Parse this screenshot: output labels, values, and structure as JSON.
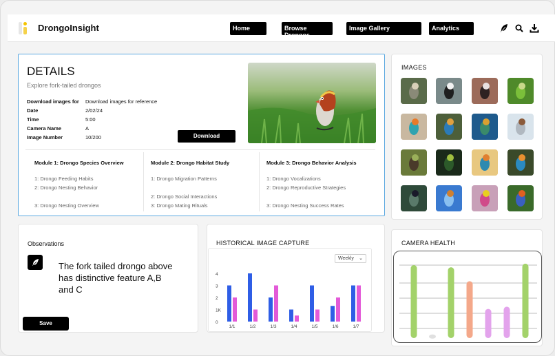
{
  "brand": {
    "name": "DrongoInsight"
  },
  "nav": {
    "home": "Home",
    "browse": "Browse Drongos",
    "gallery": "Image Gallery",
    "analytics": "Analytics"
  },
  "details": {
    "title": "DETAILS",
    "subtitle": "Explore fork-tailed drongos",
    "fields": [
      {
        "key": "Download images for",
        "value": "Download images for reference"
      },
      {
        "key": "Date",
        "value": "2/02/24"
      },
      {
        "key": "Time",
        "value": "5:00"
      },
      {
        "key": "Camera Name",
        "value": "A"
      },
      {
        "key": "Image Number",
        "value": "10/200"
      }
    ],
    "download_label": "Download",
    "modules": [
      {
        "title": "Module 1: Drongo Species Overview",
        "items": [
          "1: Drongo Feeding Habits",
          "2: Drongo Nesting Behavior",
          "3: Drongo Nesting Overview"
        ]
      },
      {
        "title": "Module 2: Drongo Habitat Study",
        "items": [
          "1: Drongo Migration Patterns",
          "2: Drongo Social Interactions",
          "3: Drongo Mating Rituals"
        ]
      },
      {
        "title": "Module 3: Drongo Behavior Analysis",
        "items": [
          "1: Drongo Vocalizations",
          "2: Drongo Reproductive Strategies",
          "3: Drongo Nesting Success Rates"
        ]
      }
    ]
  },
  "images": {
    "title": "IMAGES"
  },
  "observations": {
    "title": "Observations",
    "text": "The fork tailed drongo above has distinctive feature A,B and C",
    "save_label": "Save"
  },
  "history": {
    "title": "HISTORICAL IMAGE CAPTURE",
    "period": "Weekly"
  },
  "camera_health": {
    "title": "CAMERA HEALTH"
  },
  "colors": {
    "series_a": "#2f5ee6",
    "series_b": "#e35ad8",
    "health_green": "#a3d26a",
    "health_salmon": "#f4a88a",
    "health_lilac": "#e3a3ec",
    "accent_border": "#5aa8e0"
  },
  "chart_data": [
    {
      "type": "bar",
      "categories": [
        "1/1",
        "1/2",
        "1/3",
        "1/4",
        "1/5",
        "1/6",
        "1/7"
      ],
      "y_ticks": [
        "0",
        "1K",
        "2",
        "3",
        "4"
      ],
      "ylim": [
        0,
        4
      ],
      "series": [
        {
          "values": [
            3,
            4,
            2,
            1,
            3,
            1.3,
            3
          ]
        },
        {
          "values": [
            2,
            1,
            3,
            0.5,
            1,
            2,
            3
          ]
        }
      ]
    },
    {
      "type": "bar",
      "ylim": [
        0,
        1
      ],
      "grid": true,
      "series": [
        {
          "values": [
            1.0,
            0.05,
            0.97,
            0.78,
            0.4,
            0.43,
            1.02
          ],
          "colors": [
            "green",
            "gray",
            "green",
            "salmon",
            "lilac",
            "lilac",
            "green"
          ]
        }
      ]
    }
  ]
}
